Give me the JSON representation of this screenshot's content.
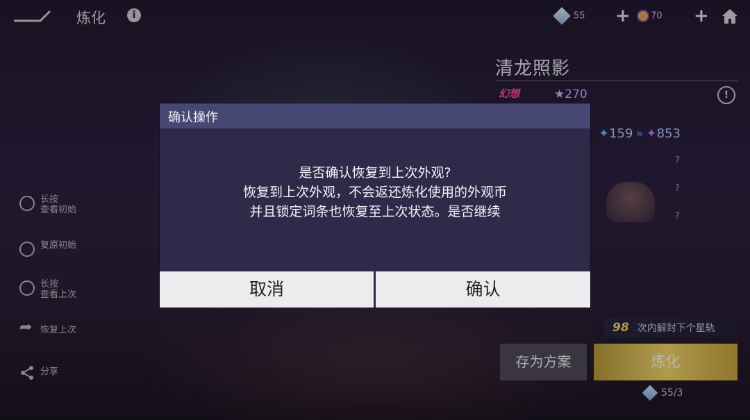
{
  "topbar": {
    "title": "炼化",
    "currency1_value": "55",
    "currency2_value": "70"
  },
  "item": {
    "name": "清龙照影",
    "star_value": "270",
    "star_from": "159",
    "star_to": "853",
    "unknown_marks": [
      "?",
      "?",
      "?"
    ]
  },
  "sidebar": {
    "items": [
      {
        "label": "长按\n查看初始"
      },
      {
        "label": "复原初始"
      },
      {
        "label": "长按\n查看上次"
      },
      {
        "label": "恢复上次"
      },
      {
        "label": "分享"
      }
    ]
  },
  "unlock": {
    "count": "98",
    "text": "次内解封下个星轨"
  },
  "actions": {
    "save_label": "存为方案",
    "refine_label": "炼化",
    "cost": "55/3"
  },
  "dialog": {
    "title": "确认操作",
    "line1": "是否确认恢复到上次外观?",
    "line2": "恢复到上次外观，不会返还炼化使用的外观币",
    "line3": "并且锁定词条也恢复至上次状态。是否继续",
    "cancel_label": "取消",
    "confirm_label": "确认"
  }
}
